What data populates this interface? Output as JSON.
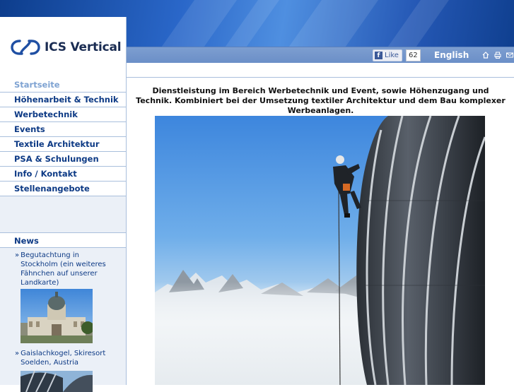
{
  "header": {
    "logo_text": "ICS Vertical",
    "facebook": {
      "label": "Like",
      "count": "62"
    },
    "language_link": "English",
    "icons": [
      "home-icon",
      "print-icon",
      "mail-icon"
    ]
  },
  "sidebar": {
    "nav": [
      {
        "label": "Startseite",
        "active": true
      },
      {
        "label": "Höhenarbeit & Technik"
      },
      {
        "label": "Werbetechnik"
      },
      {
        "label": "Events"
      },
      {
        "label": "Textile Architektur"
      },
      {
        "label": "PSA & Schulungen"
      },
      {
        "label": "Info / Kontakt"
      },
      {
        "label": "Stellenangebote"
      }
    ],
    "news_title": "News",
    "news": [
      {
        "bullet": "»",
        "text": "Begutachtung in Stockholm (ein weiteres Fähnchen auf unserer Landkarte)"
      },
      {
        "bullet": "»",
        "text": "Gaislachkogel, Skiresort Soelden, Austria"
      }
    ]
  },
  "main": {
    "intro": "Dienstleistung im Bereich Werbetechnik und Event, sowie Höhenzugang und Technik. Kombiniert bei der Umsetzung textiler Architektur und dem Bau komplexer Werbeanlagen."
  },
  "colors": {
    "brand_blue": "#0d3a85",
    "active_nav": "#7fa3d2",
    "toolbar": "#6a8ec7",
    "facebook": "#3b5998"
  }
}
